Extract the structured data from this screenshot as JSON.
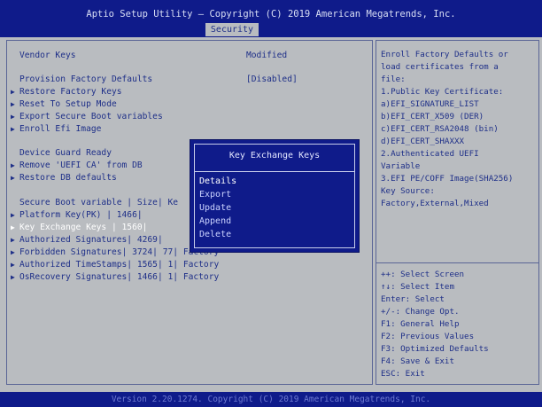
{
  "header": {
    "title": "Aptio Setup Utility – Copyright (C) 2019 American Megatrends, Inc.",
    "tab": "Security"
  },
  "main": {
    "vendor_keys_label": "Vendor Keys",
    "vendor_keys_value": "Modified",
    "provision_label": "Provision Factory Defaults",
    "provision_value": "[Disabled]",
    "menu_top": [
      "Restore Factory Keys",
      "Reset To Setup Mode",
      "Export Secure Boot variables",
      "Enroll Efi Image"
    ],
    "device_guard": "Device Guard Ready",
    "menu_mid": [
      "Remove 'UEFI CA' from DB",
      "Restore DB defaults"
    ],
    "table_header": "Secure Boot variable | Size| Ke",
    "table_rows": [
      "Platform Key(PK)     | 1466|",
      "Key Exchange Keys    | 1560|",
      "Authorized Signatures| 4269|",
      "Forbidden  Signatures| 3724|   77| Factory",
      "Authorized TimeStamps| 1565|    1| Factory",
      "OsRecovery Signatures| 1466|    1| Factory"
    ]
  },
  "help": {
    "description": [
      "Enroll Factory Defaults or",
      "load certificates from a",
      "file:",
      " 1.Public Key Certificate:",
      "  a)EFI_SIGNATURE_LIST",
      "  b)EFI_CERT_X509 (DER)",
      "  c)EFI_CERT_RSA2048 (bin)",
      "  d)EFI_CERT_SHAXXX",
      " 2.Authenticated UEFI",
      "Variable",
      " 3.EFI PE/COFF Image(SHA256)",
      "Key Source:",
      " Factory,External,Mixed"
    ],
    "keys": [
      "++: Select Screen",
      "↑↓: Select Item",
      "Enter: Select",
      "+/-: Change Opt.",
      "F1: General Help",
      "F2: Previous Values",
      "F3: Optimized Defaults",
      "F4: Save & Exit",
      "ESC: Exit"
    ]
  },
  "popup": {
    "title": "Key Exchange Keys",
    "options": [
      "Details",
      "Export",
      "Update",
      "Append",
      "Delete"
    ],
    "selected": "Details"
  },
  "footer": {
    "text": "Version 2.20.1274. Copyright (C) 2019 American Megatrends, Inc."
  },
  "colors": {
    "bar_blue": "#0f1b8a",
    "panel_gray": "#b9bcc0",
    "text_blue": "#1e2f88",
    "highlight_white": "#ffffff"
  }
}
